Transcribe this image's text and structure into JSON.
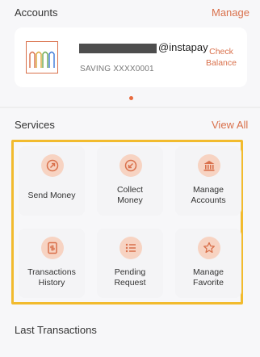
{
  "accounts": {
    "title": "Accounts",
    "manage_label": "Manage",
    "vpa_suffix": "@instapay",
    "account_type_number": "SAVING  XXXX0001",
    "check_balance_label": "Check\nBalance"
  },
  "services": {
    "title": "Services",
    "view_all_label": "View All",
    "items": [
      {
        "label": "Send Money",
        "icon": "arrow-up-right-icon"
      },
      {
        "label": "Collect\nMoney",
        "icon": "arrow-down-left-icon"
      },
      {
        "label": "Manage\nAccounts",
        "icon": "bank-icon"
      },
      {
        "label": "Transactions\nHistory",
        "icon": "history-doc-icon"
      },
      {
        "label": "Pending\nRequest",
        "icon": "list-icon"
      },
      {
        "label": "Manage\nFavorite",
        "icon": "star-icon"
      }
    ]
  },
  "last_transactions": {
    "title": "Last Transactions"
  },
  "colors": {
    "accent": "#d9704b",
    "icon_bg": "#f7d3c2",
    "highlight_border": "#f2bb2e"
  }
}
